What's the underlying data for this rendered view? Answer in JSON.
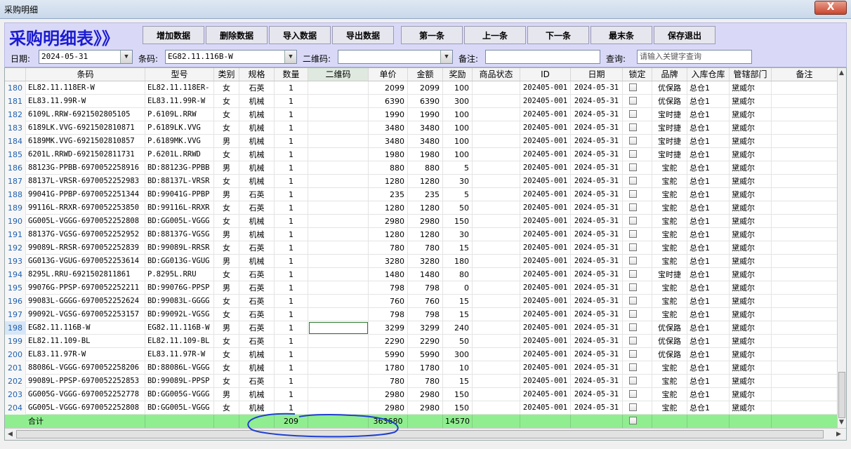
{
  "window": {
    "title": "采购明细",
    "close_label": "X"
  },
  "header": {
    "title": "采购明细表》》"
  },
  "toolbar": {
    "add": "增加数据",
    "delete": "删除数据",
    "import": "导入数据",
    "export": "导出数据",
    "first": "第一条",
    "prev": "上一条",
    "next": "下一条",
    "last": "最末条",
    "save_exit": "保存退出"
  },
  "filters": {
    "date_label": "日期:",
    "date_value": "2024-05-31",
    "barcode_label": "条码:",
    "barcode_value": "EG82.11.116B-W",
    "qr_label": "二维码:",
    "qr_value": "",
    "note_label": "备注:",
    "note_value": "",
    "query_label": "查询:",
    "query_placeholder": "请输入关键字查询"
  },
  "table": {
    "headers": [
      "条码",
      "型号",
      "类别",
      "规格",
      "数量",
      "二维码",
      "单价",
      "金额",
      "奖励",
      "商品状态",
      "ID",
      "日期",
      "锁定",
      "品牌",
      "入库仓库",
      "管辖部门",
      "备注"
    ],
    "rows": [
      [
        "180",
        "EL82.11.118ER-W",
        "EL82.11.118ER-",
        "女",
        "石英",
        "1",
        "",
        "2099",
        "2099",
        "100",
        "",
        "202405-001",
        "2024-05-31",
        "",
        "优保路",
        "总仓1",
        "黛威尔",
        ""
      ],
      [
        "181",
        "EL83.11.99R-W",
        "EL83.11.99R-W",
        "女",
        "机械",
        "1",
        "",
        "6390",
        "6390",
        "300",
        "",
        "202405-001",
        "2024-05-31",
        "",
        "优保路",
        "总仓1",
        "黛威尔",
        ""
      ],
      [
        "182",
        "6109L.RRW-6921502805105",
        "P.6109L.RRW",
        "女",
        "机械",
        "1",
        "",
        "1990",
        "1990",
        "100",
        "",
        "202405-001",
        "2024-05-31",
        "",
        "宝时捷",
        "总仓1",
        "黛威尔",
        ""
      ],
      [
        "183",
        "6189LK.VVG-6921502810871",
        "P.6189LK.VVG",
        "女",
        "机械",
        "1",
        "",
        "3480",
        "3480",
        "100",
        "",
        "202405-001",
        "2024-05-31",
        "",
        "宝时捷",
        "总仓1",
        "黛威尔",
        ""
      ],
      [
        "184",
        "6189MK.VVG-6921502810857",
        "P.6189MK.VVG",
        "男",
        "机械",
        "1",
        "",
        "3480",
        "3480",
        "100",
        "",
        "202405-001",
        "2024-05-31",
        "",
        "宝时捷",
        "总仓1",
        "黛威尔",
        ""
      ],
      [
        "185",
        "6201L.RRWD-6921502811731",
        "P.6201L.RRWD",
        "女",
        "机械",
        "1",
        "",
        "1980",
        "1980",
        "100",
        "",
        "202405-001",
        "2024-05-31",
        "",
        "宝时捷",
        "总仓1",
        "黛威尔",
        ""
      ],
      [
        "186",
        "88123G-PPBB-6970052258916",
        "BD:88123G-PPBB",
        "男",
        "机械",
        "1",
        "",
        "880",
        "880",
        "5",
        "",
        "202405-001",
        "2024-05-31",
        "",
        "宝舵",
        "总仓1",
        "黛威尔",
        ""
      ],
      [
        "187",
        "88137L-VRSR-6970052252983",
        "BD:88137L-VRSR",
        "女",
        "机械",
        "1",
        "",
        "1280",
        "1280",
        "30",
        "",
        "202405-001",
        "2024-05-31",
        "",
        "宝舵",
        "总仓1",
        "黛威尔",
        ""
      ],
      [
        "188",
        "99041G-PPBP-6970052251344",
        "BD:99041G-PPBP",
        "男",
        "石英",
        "1",
        "",
        "235",
        "235",
        "5",
        "",
        "202405-001",
        "2024-05-31",
        "",
        "宝舵",
        "总仓1",
        "黛威尔",
        ""
      ],
      [
        "189",
        "99116L-RRXR-6970052253850",
        "BD:99116L-RRXR",
        "女",
        "石英",
        "1",
        "",
        "1280",
        "1280",
        "50",
        "",
        "202405-001",
        "2024-05-31",
        "",
        "宝舵",
        "总仓1",
        "黛威尔",
        ""
      ],
      [
        "190",
        "GG005L-VGGG-6970052252808",
        "BD:GG005L-VGGG",
        "女",
        "机械",
        "1",
        "",
        "2980",
        "2980",
        "150",
        "",
        "202405-001",
        "2024-05-31",
        "",
        "宝舵",
        "总仓1",
        "黛威尔",
        ""
      ],
      [
        "191",
        "88137G-VGSG-6970052252952",
        "BD:88137G-VGSG",
        "男",
        "机械",
        "1",
        "",
        "1280",
        "1280",
        "30",
        "",
        "202405-001",
        "2024-05-31",
        "",
        "宝舵",
        "总仓1",
        "黛威尔",
        ""
      ],
      [
        "192",
        "99089L-RRSR-6970052252839",
        "BD:99089L-RRSR",
        "女",
        "石英",
        "1",
        "",
        "780",
        "780",
        "15",
        "",
        "202405-001",
        "2024-05-31",
        "",
        "宝舵",
        "总仓1",
        "黛威尔",
        ""
      ],
      [
        "193",
        "GG013G-VGUG-6970052253614",
        "BD:GG013G-VGUG",
        "男",
        "机械",
        "1",
        "",
        "3280",
        "3280",
        "180",
        "",
        "202405-001",
        "2024-05-31",
        "",
        "宝舵",
        "总仓1",
        "黛威尔",
        ""
      ],
      [
        "194",
        "8295L.RRU-6921502811861",
        "P.8295L.RRU",
        "女",
        "石英",
        "1",
        "",
        "1480",
        "1480",
        "80",
        "",
        "202405-001",
        "2024-05-31",
        "",
        "宝时捷",
        "总仓1",
        "黛威尔",
        ""
      ],
      [
        "195",
        "99076G-PPSP-6970052252211",
        "BD:99076G-PPSP",
        "男",
        "石英",
        "1",
        "",
        "798",
        "798",
        "0",
        "",
        "202405-001",
        "2024-05-31",
        "",
        "宝舵",
        "总仓1",
        "黛威尔",
        ""
      ],
      [
        "196",
        "99083L-GGGG-6970052252624",
        "BD:99083L-GGGG",
        "女",
        "石英",
        "1",
        "",
        "760",
        "760",
        "15",
        "",
        "202405-001",
        "2024-05-31",
        "",
        "宝舵",
        "总仓1",
        "黛威尔",
        ""
      ],
      [
        "197",
        "99092L-VGSG-6970052253157",
        "BD:99092L-VGSG",
        "女",
        "石英",
        "1",
        "",
        "798",
        "798",
        "15",
        "",
        "202405-001",
        "2024-05-31",
        "",
        "宝舵",
        "总仓1",
        "黛威尔",
        ""
      ],
      [
        "198",
        "EG82.11.116B-W",
        "EG82.11.116B-W",
        "男",
        "石英",
        "1",
        "",
        "3299",
        "3299",
        "240",
        "",
        "202405-001",
        "2024-05-31",
        "",
        "优保路",
        "总仓1",
        "黛威尔",
        ""
      ],
      [
        "199",
        "EL82.11.109-BL",
        "EL82.11.109-BL",
        "女",
        "石英",
        "1",
        "",
        "2290",
        "2290",
        "50",
        "",
        "202405-001",
        "2024-05-31",
        "",
        "优保路",
        "总仓1",
        "黛威尔",
        ""
      ],
      [
        "200",
        "EL83.11.97R-W",
        "EL83.11.97R-W",
        "女",
        "机械",
        "1",
        "",
        "5990",
        "5990",
        "300",
        "",
        "202405-001",
        "2024-05-31",
        "",
        "优保路",
        "总仓1",
        "黛威尔",
        ""
      ],
      [
        "201",
        "88086L-VGGG-6970052258206",
        "BD:88086L-VGGG",
        "女",
        "机械",
        "1",
        "",
        "1780",
        "1780",
        "10",
        "",
        "202405-001",
        "2024-05-31",
        "",
        "宝舵",
        "总仓1",
        "黛威尔",
        ""
      ],
      [
        "202",
        "99089L-PPSP-6970052252853",
        "BD:99089L-PPSP",
        "女",
        "石英",
        "1",
        "",
        "780",
        "780",
        "15",
        "",
        "202405-001",
        "2024-05-31",
        "",
        "宝舵",
        "总仓1",
        "黛威尔",
        ""
      ],
      [
        "203",
        "GG005G-VGGG-6970052252778",
        "BD:GG005G-VGGG",
        "男",
        "机械",
        "1",
        "",
        "2980",
        "2980",
        "150",
        "",
        "202405-001",
        "2024-05-31",
        "",
        "宝舵",
        "总仓1",
        "黛威尔",
        ""
      ],
      [
        "204",
        "GG005L-VGGG-6970052252808",
        "BD:GG005L-VGGG",
        "女",
        "机械",
        "1",
        "",
        "2980",
        "2980",
        "150",
        "",
        "202405-001",
        "2024-05-31",
        "",
        "宝舵",
        "总仓1",
        "黛威尔",
        ""
      ]
    ],
    "selected_row": "198",
    "total": {
      "label": "合计",
      "qty": "209",
      "price": "363680",
      "reward": "14570"
    }
  }
}
